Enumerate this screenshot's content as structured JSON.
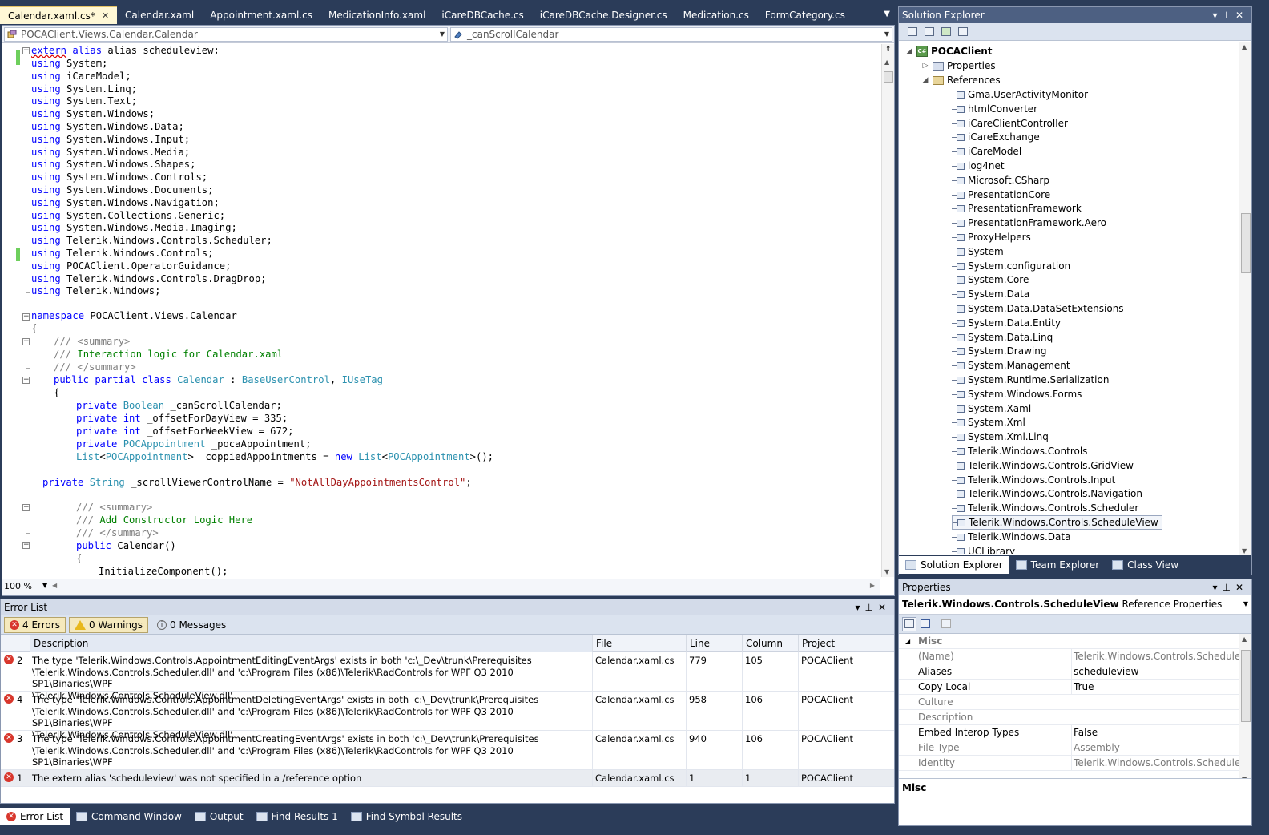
{
  "tabs": [
    {
      "label": "Calendar.xaml.cs*",
      "active": true
    },
    {
      "label": "Calendar.xaml"
    },
    {
      "label": "Appointment.xaml.cs"
    },
    {
      "label": "MedicationInfo.xaml"
    },
    {
      "label": "iCareDBCache.cs"
    },
    {
      "label": "iCareDBCache.Designer.cs"
    },
    {
      "label": "Medication.cs"
    },
    {
      "label": "FormCategory.cs"
    }
  ],
  "navbar": {
    "type_selector": "POCAClient.Views.Calendar.Calendar",
    "member_selector": "_canScrollCalendar"
  },
  "code": {
    "l1": "alias scheduleview;",
    "usings": [
      "System;",
      "iCareModel;",
      "System.Linq;",
      "System.Text;",
      "System.Windows;",
      "System.Windows.Data;",
      "System.Windows.Input;",
      "System.Windows.Media;",
      "System.Windows.Shapes;",
      "System.Windows.Controls;",
      "System.Windows.Documents;",
      "System.Windows.Navigation;",
      "System.Collections.Generic;",
      "System.Windows.Media.Imaging;",
      "Telerik.Windows.Controls.Scheduler;",
      "Telerik.Windows.Controls;",
      "POCAClient.OperatorGuidance;",
      "Telerik.Windows.Controls.DragDrop;",
      "Telerik.Windows;"
    ],
    "kw_extern": "extern",
    "kw_using": "using",
    "ns_line": "POCAClient.Views.Calendar",
    "brace_open": "{",
    "summary_open": "<summary>",
    "summary_close": "</summary>",
    "doc_slashes": "///",
    "class_doc": "Interaction logic for Calendar.xaml",
    "class_name": "Calendar",
    "base_class": "BaseUserControl",
    "interface": "IUseTag",
    "f1": "_canScrollCalendar;",
    "f2": "_offsetForDayView = 335;",
    "f3": "_offsetForWeekView = 672;",
    "f4": "_pocaAppointment;",
    "f5a": "> _coppiedAppointments = ",
    "f5b": ">();",
    "f6a": "_scrollViewerControlName = ",
    "f6b": "\"NotAllDayAppointmentsControl\"",
    "ctor_doc": "Add Constructor Logic Here",
    "ctor": "Calendar()",
    "init": "InitializeComponent();",
    "kw_namespace": "namespace",
    "kw_public": "public",
    "kw_partial": "partial",
    "kw_class": "class",
    "kw_private": "private",
    "kw_int": "int",
    "kw_new": "new",
    "ty_boolean": "Boolean",
    "ty_string": "String",
    "ty_list": "List",
    "ty_poca": "POCAppointment",
    "colon": ":",
    "comma": ","
  },
  "zoom": "100 %",
  "error_list": {
    "title": "Error List",
    "filters": {
      "errors": "4 Errors",
      "warnings": "0 Warnings",
      "messages": "0 Messages"
    },
    "columns": [
      "Description",
      "File",
      "Line",
      "Column",
      "Project"
    ],
    "rows": [
      {
        "num": "2",
        "desc": [
          "The type 'Telerik.Windows.Controls.AppointmentEditingEventArgs' exists in both 'c:\\_Dev\\trunk\\Prerequisites",
          "\\Telerik.Windows.Controls.Scheduler.dll' and 'c:\\Program Files (x86)\\Telerik\\RadControls for WPF Q3 2010 SP1\\Binaries\\WPF",
          "\\Telerik.Windows.Controls.ScheduleView.dll'"
        ],
        "file": "Calendar.xaml.cs",
        "line": "779",
        "column": "105",
        "project": "POCAClient"
      },
      {
        "num": "4",
        "desc": [
          "The type 'Telerik.Windows.Controls.AppointmentDeletingEventArgs' exists in both 'c:\\_Dev\\trunk\\Prerequisites",
          "\\Telerik.Windows.Controls.Scheduler.dll' and 'c:\\Program Files (x86)\\Telerik\\RadControls for WPF Q3 2010 SP1\\Binaries\\WPF",
          "\\Telerik.Windows.Controls.ScheduleView.dll'"
        ],
        "file": "Calendar.xaml.cs",
        "line": "958",
        "column": "106",
        "project": "POCAClient"
      },
      {
        "num": "3",
        "desc": [
          "The type 'Telerik.Windows.Controls.AppointmentCreatingEventArgs' exists in both 'c:\\_Dev\\trunk\\Prerequisites",
          "\\Telerik.Windows.Controls.Scheduler.dll' and 'c:\\Program Files (x86)\\Telerik\\RadControls for WPF Q3 2010 SP1\\Binaries\\WPF",
          "\\Telerik.Windows.Controls.ScheduleView.dll'"
        ],
        "file": "Calendar.xaml.cs",
        "line": "940",
        "column": "106",
        "project": "POCAClient"
      },
      {
        "num": "1",
        "desc": [
          "The extern alias 'scheduleview' was not specified in a /reference option"
        ],
        "file": "Calendar.xaml.cs",
        "line": "1",
        "column": "1",
        "project": "POCAClient"
      }
    ]
  },
  "bottom_tabs": [
    "Error List",
    "Command Window",
    "Output",
    "Find Results 1",
    "Find Symbol Results"
  ],
  "solution_explorer": {
    "title": "Solution Explorer",
    "project": "POCAClient",
    "properties": "Properties",
    "references": "References",
    "refs": [
      "Gma.UserActivityMonitor",
      "htmlConverter",
      "iCareClientController",
      "iCareExchange",
      "iCareModel",
      "log4net",
      "Microsoft.CSharp",
      "PresentationCore",
      "PresentationFramework",
      "PresentationFramework.Aero",
      "ProxyHelpers",
      "System",
      "System.configuration",
      "System.Core",
      "System.Data",
      "System.Data.DataSetExtensions",
      "System.Data.Entity",
      "System.Data.Linq",
      "System.Drawing",
      "System.Management",
      "System.Runtime.Serialization",
      "System.Windows.Forms",
      "System.Xaml",
      "System.Xml",
      "System.Xml.Linq",
      "Telerik.Windows.Controls",
      "Telerik.Windows.Controls.GridView",
      "Telerik.Windows.Controls.Input",
      "Telerik.Windows.Controls.Navigation",
      "Telerik.Windows.Controls.Scheduler",
      "Telerik.Windows.Controls.ScheduleView",
      "Telerik.Windows.Data",
      "UCLibrary"
    ],
    "selected_ref": "Telerik.Windows.Controls.ScheduleView",
    "tabs": [
      "Solution Explorer",
      "Team Explorer",
      "Class View"
    ]
  },
  "properties": {
    "title": "Properties",
    "object_name": "Telerik.Windows.Controls.ScheduleView",
    "object_kind": "Reference Properties",
    "category": "Misc",
    "rows": [
      {
        "name": "(Name)",
        "value": "Telerik.Windows.Controls.ScheduleView",
        "readonly": true
      },
      {
        "name": "Aliases",
        "value": "scheduleview",
        "readonly": false
      },
      {
        "name": "Copy Local",
        "value": "True",
        "readonly": false
      },
      {
        "name": "Culture",
        "value": "",
        "readonly": true
      },
      {
        "name": "Description",
        "value": "",
        "readonly": true
      },
      {
        "name": "Embed Interop Types",
        "value": "False",
        "readonly": false
      },
      {
        "name": "File Type",
        "value": "Assembly",
        "readonly": true
      },
      {
        "name": "Identity",
        "value": "Telerik.Windows.Controls.ScheduleView",
        "readonly": true
      }
    ],
    "description_title": "Misc"
  }
}
